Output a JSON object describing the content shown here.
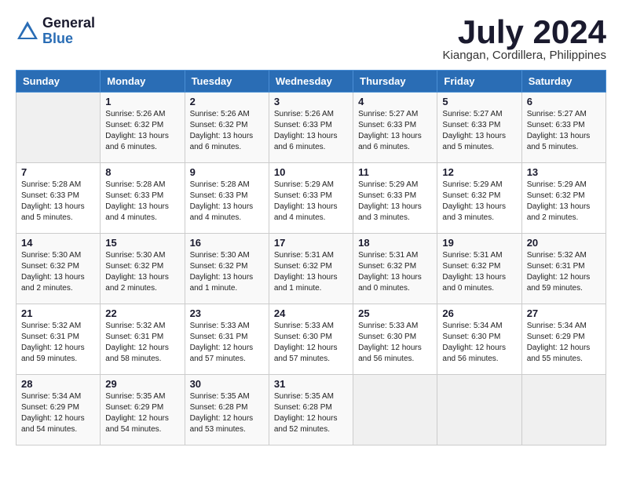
{
  "header": {
    "logo_general": "General",
    "logo_blue": "Blue",
    "month": "July 2024",
    "location": "Kiangan, Cordillera, Philippines"
  },
  "days_of_week": [
    "Sunday",
    "Monday",
    "Tuesday",
    "Wednesday",
    "Thursday",
    "Friday",
    "Saturday"
  ],
  "weeks": [
    [
      {
        "num": "",
        "info": ""
      },
      {
        "num": "1",
        "info": "Sunrise: 5:26 AM\nSunset: 6:32 PM\nDaylight: 13 hours\nand 6 minutes."
      },
      {
        "num": "2",
        "info": "Sunrise: 5:26 AM\nSunset: 6:32 PM\nDaylight: 13 hours\nand 6 minutes."
      },
      {
        "num": "3",
        "info": "Sunrise: 5:26 AM\nSunset: 6:33 PM\nDaylight: 13 hours\nand 6 minutes."
      },
      {
        "num": "4",
        "info": "Sunrise: 5:27 AM\nSunset: 6:33 PM\nDaylight: 13 hours\nand 6 minutes."
      },
      {
        "num": "5",
        "info": "Sunrise: 5:27 AM\nSunset: 6:33 PM\nDaylight: 13 hours\nand 5 minutes."
      },
      {
        "num": "6",
        "info": "Sunrise: 5:27 AM\nSunset: 6:33 PM\nDaylight: 13 hours\nand 5 minutes."
      }
    ],
    [
      {
        "num": "7",
        "info": "Sunrise: 5:28 AM\nSunset: 6:33 PM\nDaylight: 13 hours\nand 5 minutes."
      },
      {
        "num": "8",
        "info": "Sunrise: 5:28 AM\nSunset: 6:33 PM\nDaylight: 13 hours\nand 4 minutes."
      },
      {
        "num": "9",
        "info": "Sunrise: 5:28 AM\nSunset: 6:33 PM\nDaylight: 13 hours\nand 4 minutes."
      },
      {
        "num": "10",
        "info": "Sunrise: 5:29 AM\nSunset: 6:33 PM\nDaylight: 13 hours\nand 4 minutes."
      },
      {
        "num": "11",
        "info": "Sunrise: 5:29 AM\nSunset: 6:33 PM\nDaylight: 13 hours\nand 3 minutes."
      },
      {
        "num": "12",
        "info": "Sunrise: 5:29 AM\nSunset: 6:32 PM\nDaylight: 13 hours\nand 3 minutes."
      },
      {
        "num": "13",
        "info": "Sunrise: 5:29 AM\nSunset: 6:32 PM\nDaylight: 13 hours\nand 2 minutes."
      }
    ],
    [
      {
        "num": "14",
        "info": "Sunrise: 5:30 AM\nSunset: 6:32 PM\nDaylight: 13 hours\nand 2 minutes."
      },
      {
        "num": "15",
        "info": "Sunrise: 5:30 AM\nSunset: 6:32 PM\nDaylight: 13 hours\nand 2 minutes."
      },
      {
        "num": "16",
        "info": "Sunrise: 5:30 AM\nSunset: 6:32 PM\nDaylight: 13 hours\nand 1 minute."
      },
      {
        "num": "17",
        "info": "Sunrise: 5:31 AM\nSunset: 6:32 PM\nDaylight: 13 hours\nand 1 minute."
      },
      {
        "num": "18",
        "info": "Sunrise: 5:31 AM\nSunset: 6:32 PM\nDaylight: 13 hours\nand 0 minutes."
      },
      {
        "num": "19",
        "info": "Sunrise: 5:31 AM\nSunset: 6:32 PM\nDaylight: 13 hours\nand 0 minutes."
      },
      {
        "num": "20",
        "info": "Sunrise: 5:32 AM\nSunset: 6:31 PM\nDaylight: 12 hours\nand 59 minutes."
      }
    ],
    [
      {
        "num": "21",
        "info": "Sunrise: 5:32 AM\nSunset: 6:31 PM\nDaylight: 12 hours\nand 59 minutes."
      },
      {
        "num": "22",
        "info": "Sunrise: 5:32 AM\nSunset: 6:31 PM\nDaylight: 12 hours\nand 58 minutes."
      },
      {
        "num": "23",
        "info": "Sunrise: 5:33 AM\nSunset: 6:31 PM\nDaylight: 12 hours\nand 57 minutes."
      },
      {
        "num": "24",
        "info": "Sunrise: 5:33 AM\nSunset: 6:30 PM\nDaylight: 12 hours\nand 57 minutes."
      },
      {
        "num": "25",
        "info": "Sunrise: 5:33 AM\nSunset: 6:30 PM\nDaylight: 12 hours\nand 56 minutes."
      },
      {
        "num": "26",
        "info": "Sunrise: 5:34 AM\nSunset: 6:30 PM\nDaylight: 12 hours\nand 56 minutes."
      },
      {
        "num": "27",
        "info": "Sunrise: 5:34 AM\nSunset: 6:29 PM\nDaylight: 12 hours\nand 55 minutes."
      }
    ],
    [
      {
        "num": "28",
        "info": "Sunrise: 5:34 AM\nSunset: 6:29 PM\nDaylight: 12 hours\nand 54 minutes."
      },
      {
        "num": "29",
        "info": "Sunrise: 5:35 AM\nSunset: 6:29 PM\nDaylight: 12 hours\nand 54 minutes."
      },
      {
        "num": "30",
        "info": "Sunrise: 5:35 AM\nSunset: 6:28 PM\nDaylight: 12 hours\nand 53 minutes."
      },
      {
        "num": "31",
        "info": "Sunrise: 5:35 AM\nSunset: 6:28 PM\nDaylight: 12 hours\nand 52 minutes."
      },
      {
        "num": "",
        "info": ""
      },
      {
        "num": "",
        "info": ""
      },
      {
        "num": "",
        "info": ""
      }
    ]
  ]
}
